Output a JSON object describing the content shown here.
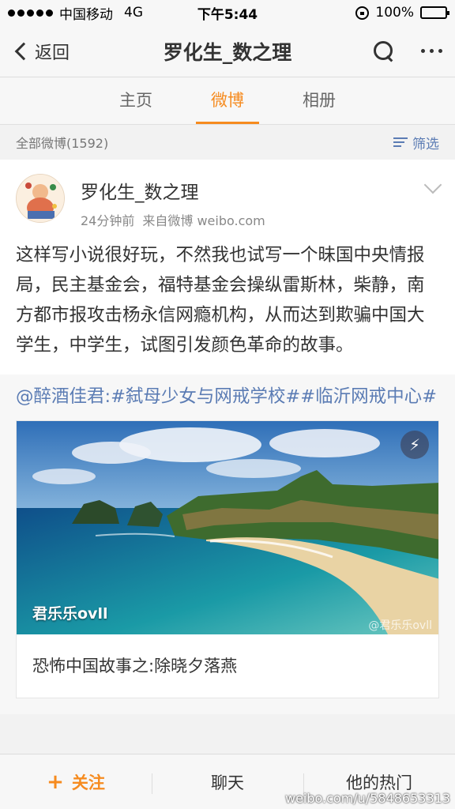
{
  "status_bar": {
    "carrier": "中国移动",
    "network": "4G",
    "time": "下午5:44",
    "battery": "100%",
    "battery_level": 1.0,
    "battery_color": "#4cd964"
  },
  "navbar": {
    "back_label": "返回",
    "title": "罗化生_数之理",
    "search_icon": "search-icon",
    "more_icon": "more-icon"
  },
  "tabs": [
    {
      "label": "主页",
      "active": false
    },
    {
      "label": "微博",
      "active": true
    },
    {
      "label": "相册",
      "active": false
    }
  ],
  "accent_color": "#f68b1f",
  "link_color": "#5b7cb4",
  "list_header": {
    "count_label": "全部微博(1592)",
    "filter_label": "筛选"
  },
  "post": {
    "author": "罗化生_数之理",
    "time": "24分钟前",
    "source": "来自微博 weibo.com",
    "text": "这样写小说很好玩，不然我也试写一个昧国中央情报局，民主基金会，福特基金会操纵雷斯林，柴静，南方都市报攻击杨永信网瘾机构，从而达到欺骗中国大学生，中学生，试图引发颜色革命的故事。",
    "repost": {
      "text": "@醉酒佳君:#弑母少女与网戒学校##临沂网戒中心#",
      "image_caption": "君乐乐ovll",
      "image_watermark": "@君乐乐ovll",
      "link_title": "恐怖中国故事之:除晓夕落燕"
    }
  },
  "toolbar": {
    "follow_label": "关注",
    "chat_label": "聊天",
    "hot_label": "他的热门"
  },
  "page_watermark": "weibo.com/u/5848653313"
}
